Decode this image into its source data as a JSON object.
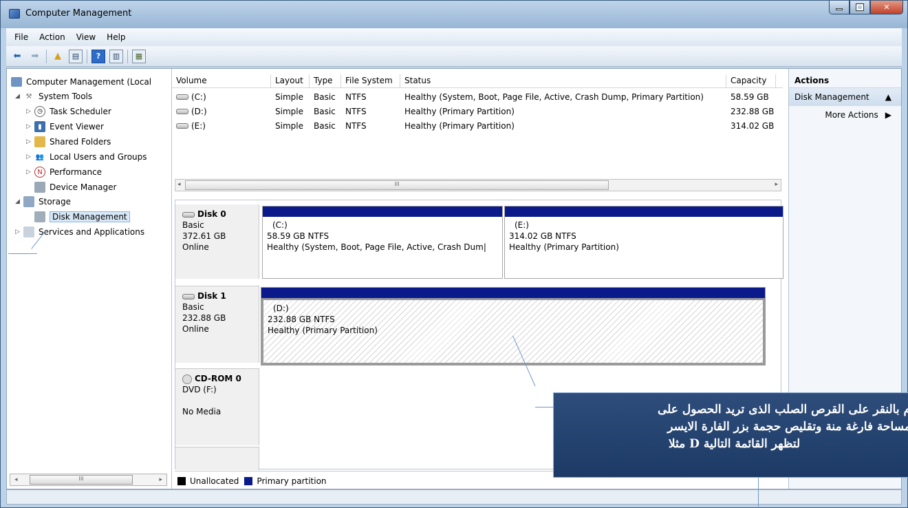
{
  "window": {
    "title": "Computer Management",
    "icon": "computer-management-icon"
  },
  "menu": [
    "File",
    "Action",
    "View",
    "Help"
  ],
  "toolbar": {
    "icons": [
      "back-arrow-icon",
      "forward-arrow-icon",
      "up-folder-icon",
      "show-hide-tree-icon",
      "help-icon",
      "show-hide-action-pane-icon",
      "properties-icon"
    ]
  },
  "tree": {
    "root": "Computer Management (Local",
    "system_tools": "System Tools",
    "task_scheduler": "Task Scheduler",
    "event_viewer": "Event Viewer",
    "shared_folders": "Shared Folders",
    "local_users": "Local Users and Groups",
    "performance": "Performance",
    "device_manager": "Device Manager",
    "storage": "Storage",
    "disk_management": "Disk Management",
    "services": "Services and Applications",
    "scroll_thumb": "III"
  },
  "volumes": {
    "headers": {
      "volume": "Volume",
      "layout": "Layout",
      "type": "Type",
      "fs": "File System",
      "status": "Status",
      "capacity": "Capacity"
    },
    "rows": [
      {
        "volume": "(C:)",
        "layout": "Simple",
        "type": "Basic",
        "fs": "NTFS",
        "status": "Healthy (System, Boot, Page File, Active, Crash Dump, Primary Partition)",
        "capacity": "58.59 GB"
      },
      {
        "volume": "(D:)",
        "layout": "Simple",
        "type": "Basic",
        "fs": "NTFS",
        "status": "Healthy (Primary Partition)",
        "capacity": "232.88 GB"
      },
      {
        "volume": "(E:)",
        "layout": "Simple",
        "type": "Basic",
        "fs": "NTFS",
        "status": "Healthy (Primary Partition)",
        "capacity": "314.02 GB"
      }
    ],
    "scroll_thumb": "III"
  },
  "disks": {
    "disk0": {
      "name": "Disk 0",
      "type": "Basic",
      "size": "372.61 GB",
      "state": "Online",
      "parts": [
        {
          "label": "(C:)",
          "size": "58.59 GB NTFS",
          "status": "Healthy (System, Boot, Page File, Active, Crash Dum|"
        },
        {
          "label": "(E:)",
          "size": "314.02 GB NTFS",
          "status": "Healthy (Primary Partition)"
        }
      ]
    },
    "disk1": {
      "name": "Disk 1",
      "type": "Basic",
      "size": "232.88 GB",
      "state": "Online",
      "parts": [
        {
          "label": "(D:)",
          "size": "232.88 GB NTFS",
          "status": "Healthy (Primary Partition)"
        }
      ]
    },
    "cdrom0": {
      "name": "CD-ROM 0",
      "type": "DVD (F:)",
      "state": "No Media"
    }
  },
  "legend": {
    "unallocated": "Unallocated",
    "primary": "Primary partition",
    "unallocated_color": "#000000",
    "primary_color": "#0b1a8a"
  },
  "actions": {
    "header": "Actions",
    "section": "Disk Management",
    "more": "More Actions"
  },
  "callout": {
    "line1": "م بالنقر على القرص الصلب الذى تريد الحصول على",
    "line2": "مساحة فارغة منة وتقليص حجمة بزر الفارة الايسر",
    "line3": "لتظهر القائمة التالية D مثلا"
  }
}
